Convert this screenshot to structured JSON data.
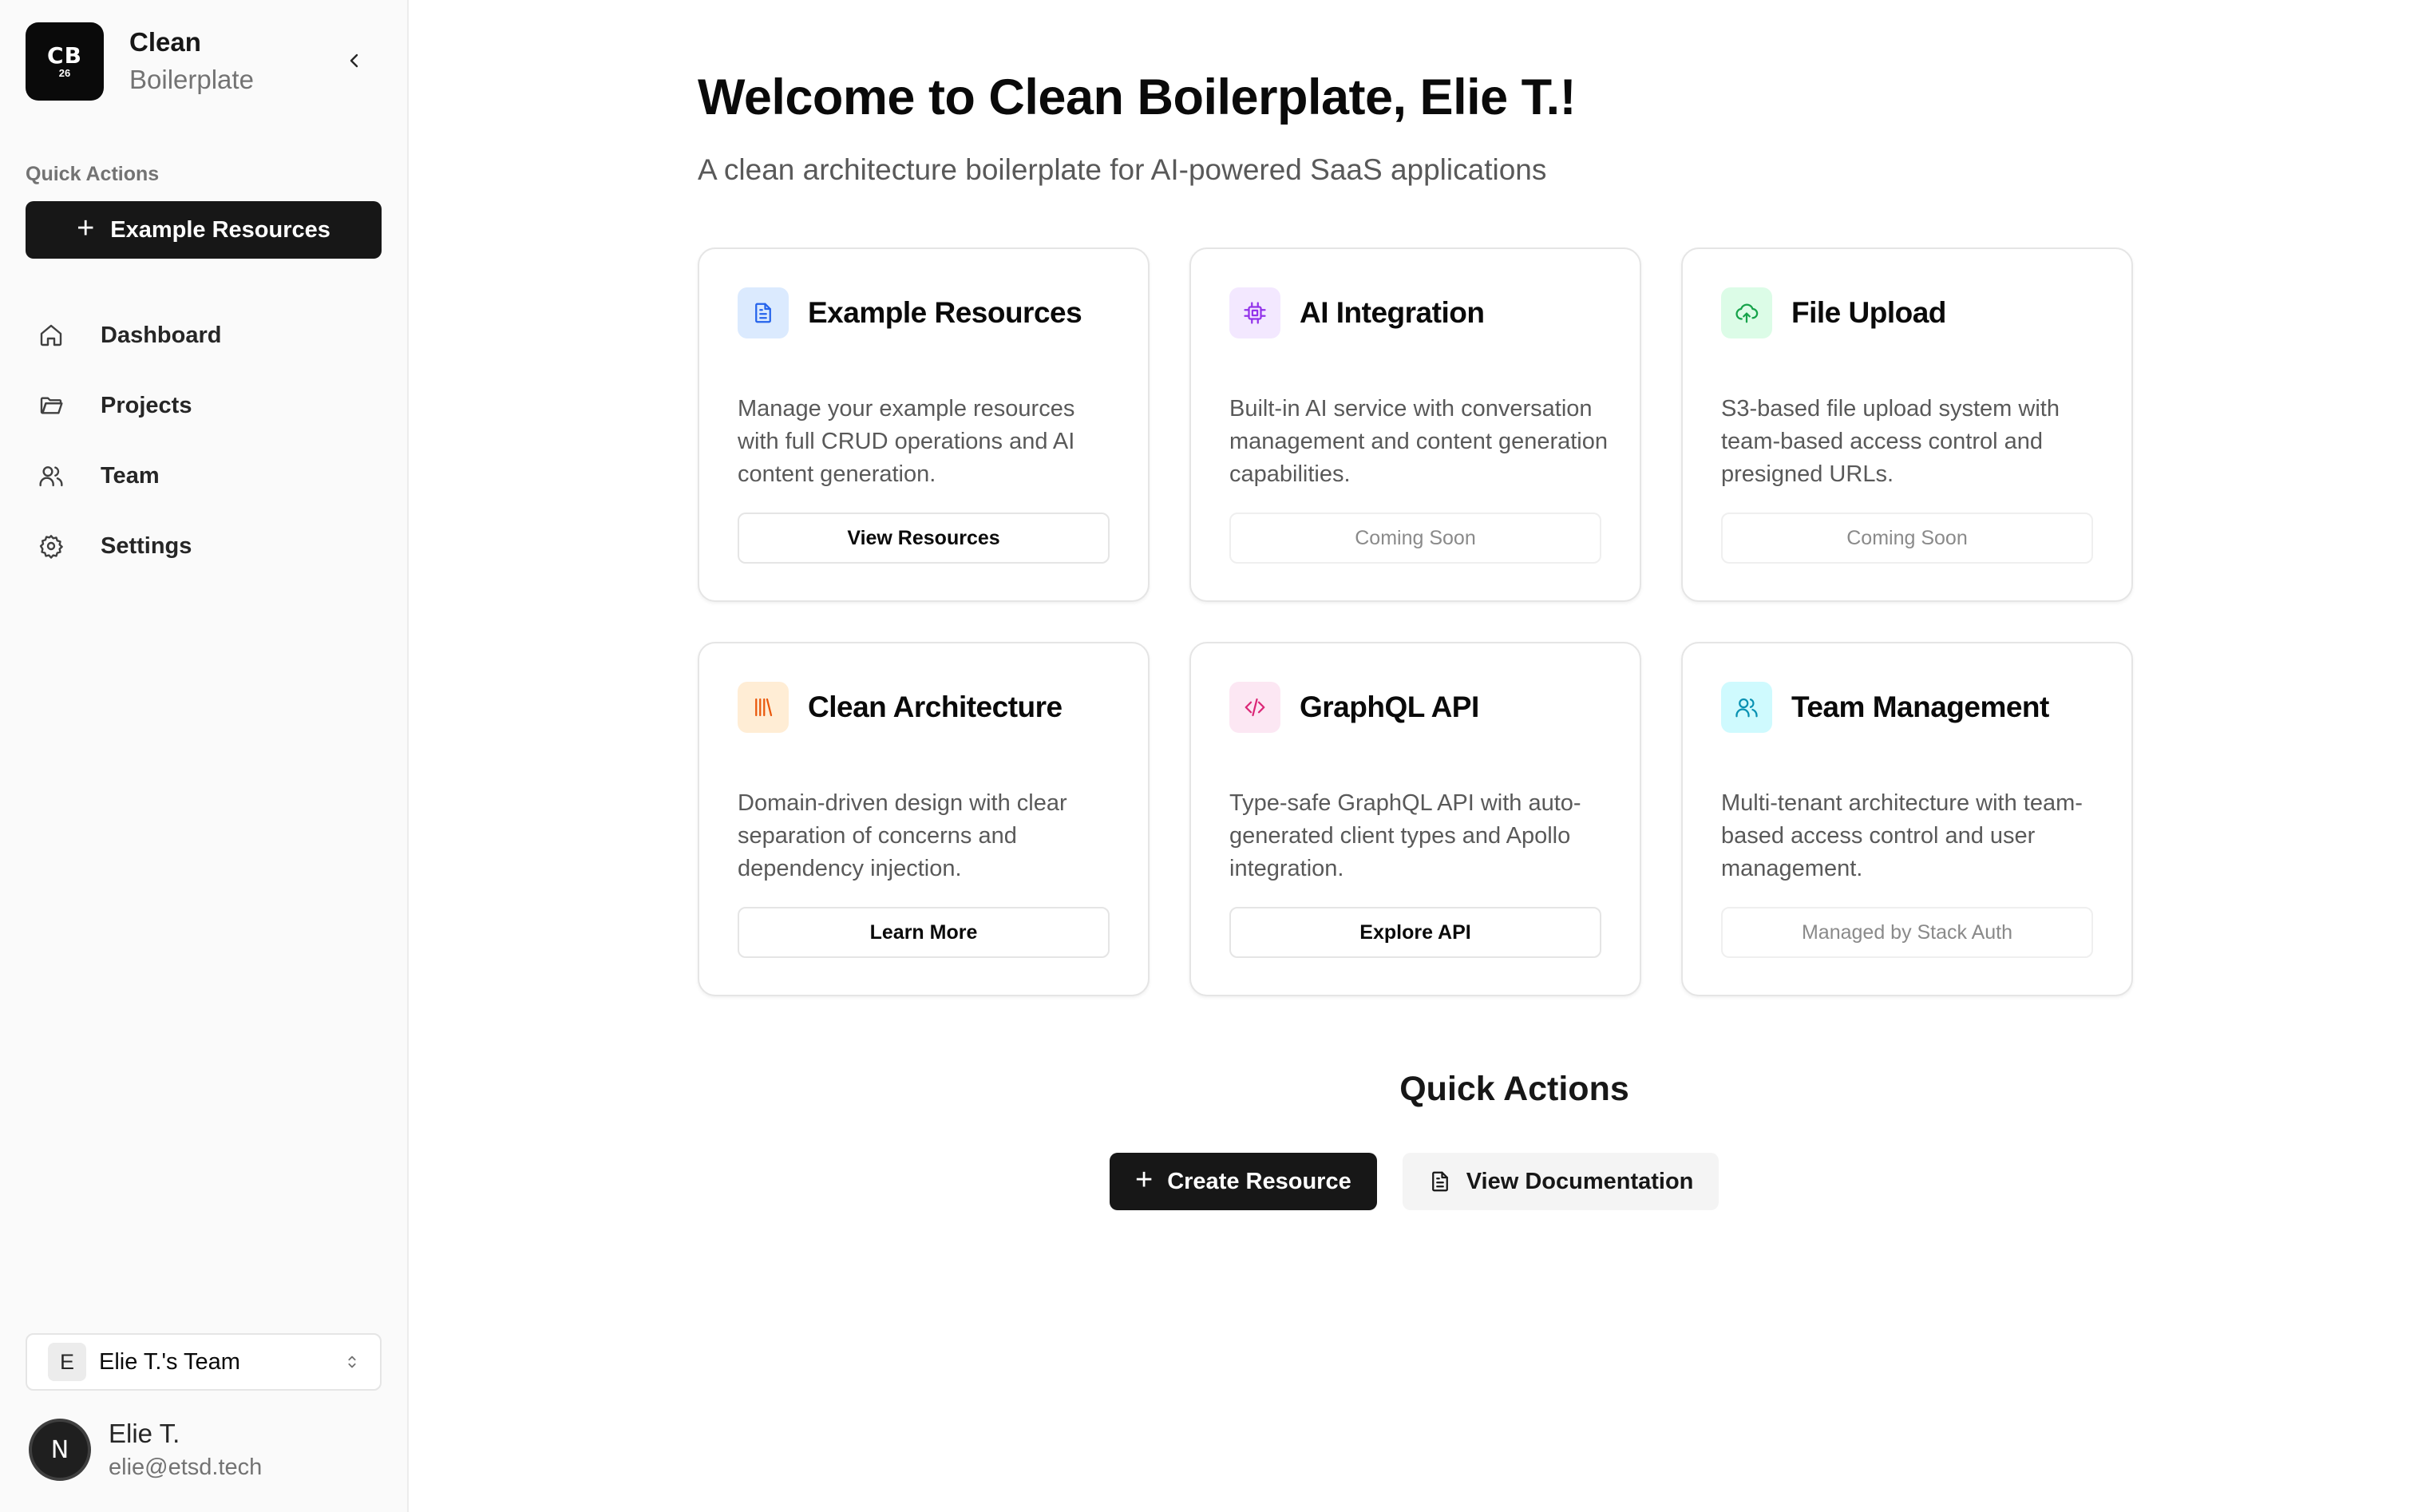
{
  "brand": {
    "logo_main": "CB",
    "logo_sub": "26",
    "title": "Clean",
    "subtitle": "Boilerplate"
  },
  "sidebar": {
    "quick_actions_label": "Quick Actions",
    "quick_action_button": "Example Resources",
    "nav": [
      {
        "label": "Dashboard",
        "icon": "home-icon"
      },
      {
        "label": "Projects",
        "icon": "folder-icon"
      },
      {
        "label": "Team",
        "icon": "users-icon"
      },
      {
        "label": "Settings",
        "icon": "gear-icon"
      }
    ],
    "team": {
      "initial": "E",
      "name": "Elie T.'s Team"
    },
    "user": {
      "initial": "N",
      "name": "Elie T.",
      "email": "elie@etsd.tech"
    }
  },
  "main": {
    "title": "Welcome to Clean Boilerplate, Elie T.!",
    "subtitle": "A clean architecture boilerplate for AI-powered SaaS applications",
    "cards": [
      {
        "title": "Example Resources",
        "icon": "document-icon",
        "accent": "#2563eb",
        "bg": "#dbeafe",
        "description": "Manage your example resources with full CRUD operations and AI content generation.",
        "button": "View Resources",
        "button_enabled": true
      },
      {
        "title": "AI Integration",
        "icon": "cpu-icon",
        "accent": "#9333ea",
        "bg": "#f3e8ff",
        "description": "Built-in AI service with conversation management and content generation capabilities.",
        "button": "Coming Soon",
        "button_enabled": false
      },
      {
        "title": "File Upload",
        "icon": "cloud-upload-icon",
        "accent": "#16a34a",
        "bg": "#dcfce7",
        "description": "S3-based file upload system with team-based access control and presigned URLs.",
        "button": "Coming Soon",
        "button_enabled": false
      },
      {
        "title": "Clean Architecture",
        "icon": "library-icon",
        "accent": "#ea580c",
        "bg": "#ffedd5",
        "description": "Domain-driven design with clear separation of concerns and dependency injection.",
        "button": "Learn More",
        "button_enabled": true
      },
      {
        "title": "GraphQL API",
        "icon": "code-icon",
        "accent": "#db2777",
        "bg": "#fce7f3",
        "description": "Type-safe GraphQL API with auto-generated client types and Apollo integration.",
        "button": "Explore API",
        "button_enabled": true
      },
      {
        "title": "Team Management",
        "icon": "users-icon",
        "accent": "#0891b2",
        "bg": "#cffafe",
        "description": "Multi-tenant architecture with team-based access control and user management.",
        "button": "Managed by Stack Auth",
        "button_enabled": false
      }
    ],
    "quick_actions": {
      "heading": "Quick Actions",
      "create": "Create Resource",
      "docs": "View Documentation"
    }
  }
}
